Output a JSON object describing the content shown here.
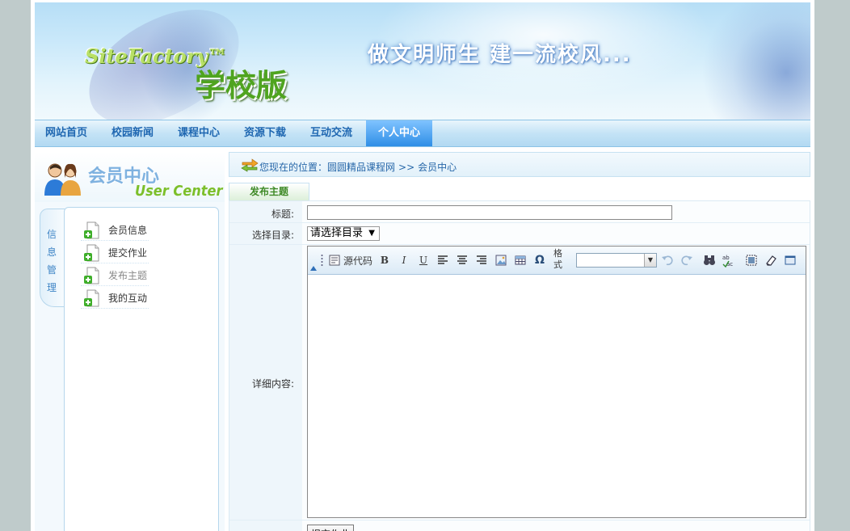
{
  "banner": {
    "brand": "SiteFactory™",
    "edition": "学校版",
    "slogan": "做文明师生  建一流校风..."
  },
  "nav": {
    "items": [
      {
        "label": "网站首页",
        "active": false
      },
      {
        "label": "校园新闻",
        "active": false
      },
      {
        "label": "课程中心",
        "active": false
      },
      {
        "label": "资源下载",
        "active": false
      },
      {
        "label": "互动交流",
        "active": false
      },
      {
        "label": "个人中心",
        "active": true
      }
    ]
  },
  "sidebar": {
    "title": "会员中心",
    "subtitle": "User Center",
    "tab_chars": [
      "信",
      "息",
      "管",
      "理"
    ],
    "items": [
      {
        "label": "会员信息",
        "enabled": true
      },
      {
        "label": "提交作业",
        "enabled": true
      },
      {
        "label": "发布主题",
        "enabled": false
      },
      {
        "label": "我的互动",
        "enabled": true
      }
    ]
  },
  "breadcrumb": {
    "prefix": "您现在的位置：",
    "site": "圆圆精品课程网",
    "separator": ">>",
    "current": "会员中心"
  },
  "tab": {
    "label": "发布主题"
  },
  "form": {
    "title_label": "标题:",
    "title_value": "",
    "dir_label": "选择目录:",
    "dir_value": "请选择目录",
    "content_label": "详细内容:",
    "submit_label": "提交作业"
  },
  "editor": {
    "source_label": "源代码",
    "format_label_1": "格",
    "format_label_2": "式",
    "bold": "B",
    "italic": "I",
    "underline": "U",
    "omega": "Ω",
    "font_value": ""
  },
  "colors": {
    "nav_active": "#2f8ee6",
    "link": "#2767a9",
    "tab_green": "#3f8a27"
  }
}
